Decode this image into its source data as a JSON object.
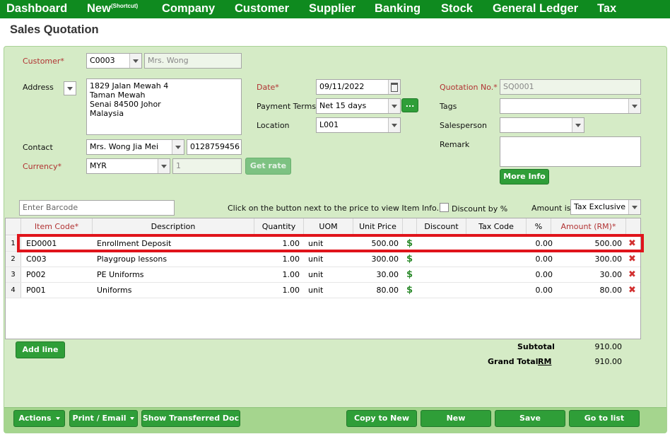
{
  "nav": {
    "items": [
      "Dashboard",
      "New",
      "Company",
      "Customer",
      "Supplier",
      "Banking",
      "Stock",
      "General Ledger",
      "Tax"
    ],
    "new_superscript": "(Shortcut)"
  },
  "page": {
    "title": "Sales Quotation"
  },
  "form": {
    "customer_label": "Customer*",
    "customer_code": "C0003",
    "customer_name": "Mrs. Wong",
    "address_label": "Address",
    "address_text": "1829 Jalan Mewah 4\nTaman Mewah\nSenai 84500 Johor\nMalaysia",
    "contact_label": "Contact",
    "contact_name": "Mrs. Wong Jia Mei",
    "contact_phone": "0128759456",
    "currency_label": "Currency*",
    "currency_value": "MYR",
    "currency_rate": "1",
    "get_rate_label": "Get rate",
    "date_label": "Date*",
    "date_value": "09/11/2022",
    "payment_terms_label": "Payment Terms",
    "payment_terms_value": "Net 15 days",
    "more_terms_label": "...",
    "location_label": "Location",
    "location_value": "L001",
    "quotation_no_label": "Quotation No.*",
    "quotation_no_value": "SQ0001",
    "tags_label": "Tags",
    "salesperson_label": "Salesperson",
    "remark_label": "Remark",
    "more_info_label": "More Info"
  },
  "items_bar": {
    "barcode_placeholder": "Enter Barcode",
    "hint": "Click on the button next to the price to view Item Info.",
    "discount_pct_label": "Discount by %",
    "amount_is_label": "Amount is:",
    "amount_is_value": "Tax Exclusive"
  },
  "grid": {
    "headers": {
      "item_code": "Item Code*",
      "description": "Description",
      "quantity": "Quantity",
      "uom": "UOM",
      "unit_price": "Unit Price",
      "discount": "Discount",
      "tax_code": "Tax Code",
      "percent": "%",
      "amount": "Amount (RM)*"
    },
    "rows": [
      {
        "no": "1",
        "item_code": "ED0001",
        "description": "Enrollment Deposit",
        "quantity": "1.00",
        "uom": "unit",
        "unit_price": "500.00",
        "discount": "",
        "tax_code": "",
        "percent": "0.00",
        "amount": "500.00"
      },
      {
        "no": "2",
        "item_code": "C003",
        "description": "Playgroup lessons",
        "quantity": "1.00",
        "uom": "unit",
        "unit_price": "300.00",
        "discount": "",
        "tax_code": "",
        "percent": "0.00",
        "amount": "300.00"
      },
      {
        "no": "3",
        "item_code": "P002",
        "description": "PE Uniforms",
        "quantity": "1.00",
        "uom": "unit",
        "unit_price": "30.00",
        "discount": "",
        "tax_code": "",
        "percent": "0.00",
        "amount": "30.00"
      },
      {
        "no": "4",
        "item_code": "P001",
        "description": "Uniforms",
        "quantity": "1.00",
        "uom": "unit",
        "unit_price": "80.00",
        "discount": "",
        "tax_code": "",
        "percent": "0.00",
        "amount": "80.00"
      }
    ],
    "dollar_glyph": "$",
    "delete_glyph": "✖"
  },
  "add_line_label": "Add line",
  "totals": {
    "subtotal_label": "Subtotal",
    "subtotal_value": "910.00",
    "grand_total_label": "Grand Total",
    "grand_total_currency": "RM",
    "grand_total_value": "910.00"
  },
  "footer": {
    "actions": "Actions",
    "print_email": "Print / Email",
    "show_transferred": "Show Transferred Doc",
    "copy_to_new": "Copy to New",
    "new": "New",
    "save": "Save",
    "go_to_list": "Go to list"
  },
  "colors": {
    "nav_bg": "#0f8a1f",
    "panel_bg": "#d5ebc6",
    "button_green": "#2f9e38",
    "required_label": "#b13232",
    "highlight_box": "#e0141b"
  }
}
